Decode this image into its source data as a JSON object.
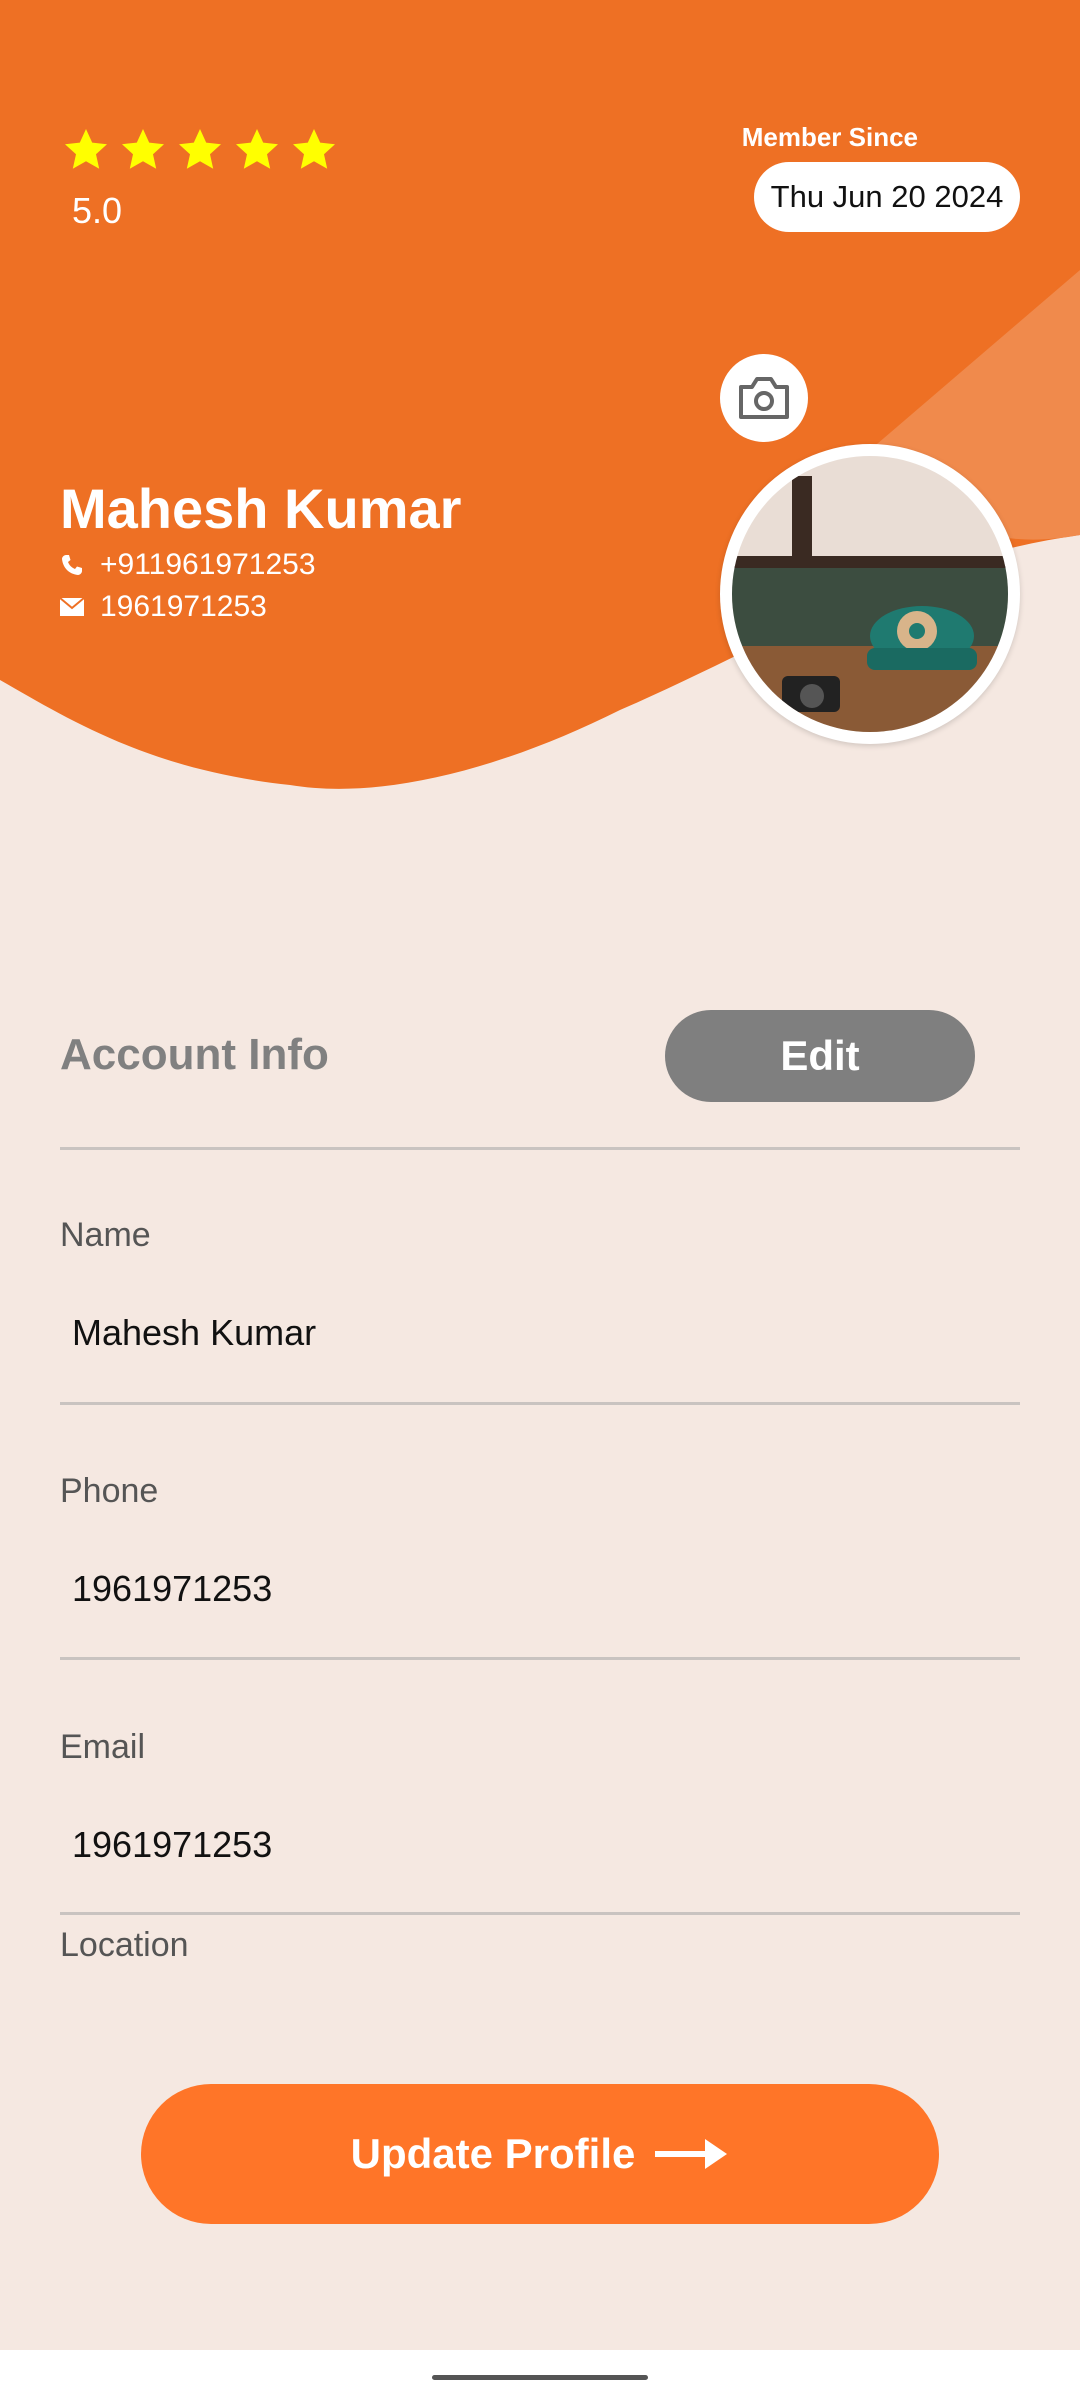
{
  "theme": {
    "accent": "#ee7024",
    "star_color": "#ffff00",
    "background": "#f5e8e1",
    "button_orange": "#ff7528",
    "edit_gray": "#7f7f7f"
  },
  "header": {
    "rating_stars": 5,
    "rating_value": "5.0",
    "member_since_label": "Member Since",
    "member_since_date": "Thu Jun 20 2024",
    "name": "Mahesh Kumar",
    "phone": "+911961971253",
    "email": "1961971253",
    "icons": {
      "camera": "camera-icon",
      "phone": "phone-icon",
      "email": "mail-icon",
      "star": "star-icon"
    }
  },
  "account": {
    "title": "Account Info",
    "edit_label": "Edit",
    "fields": [
      {
        "label": "Name",
        "value": "Mahesh Kumar"
      },
      {
        "label": "Phone",
        "value": "1961971253"
      },
      {
        "label": "Email",
        "value": "1961971253"
      },
      {
        "label": "Location",
        "value": ""
      }
    ]
  },
  "update_button": {
    "label": "Update Profile",
    "icon": "arrow-right-icon"
  }
}
